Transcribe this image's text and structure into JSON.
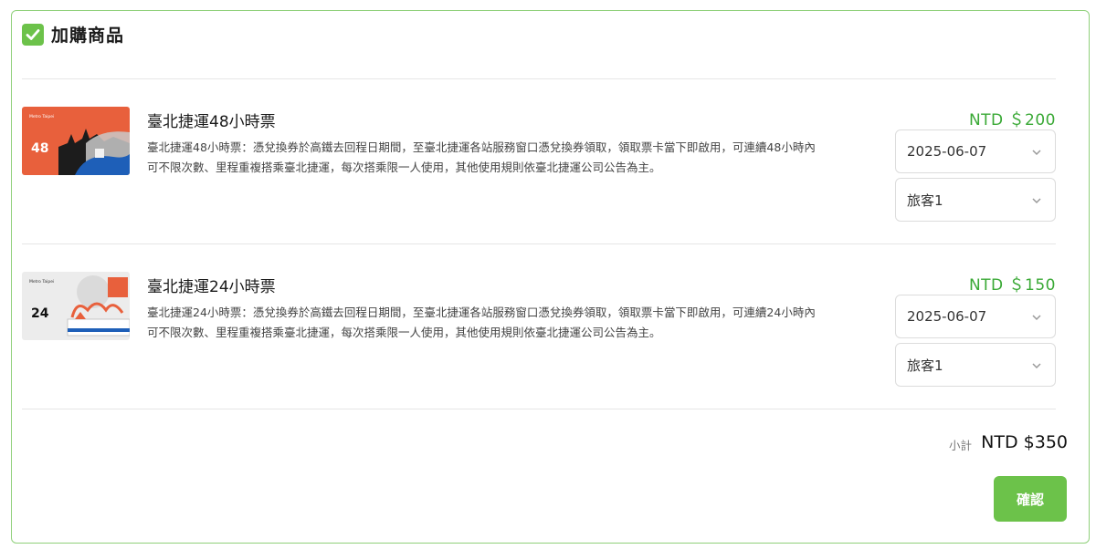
{
  "header": {
    "title": "加購商品",
    "icon": "checkbox-checked-icon"
  },
  "items": [
    {
      "name": "臺北捷運48小時票",
      "desc_line1": "臺北捷運48小時票：憑兌換券於高鐵去回程日期間，至臺北捷運各站服務窗口憑兌換券領取，領取票卡當下即啟用，可連續48小時內",
      "desc_line2": "可不限次數、里程重複搭乘臺北捷運，每次搭乘限一人使用，其他使用規則依臺北捷運公司公告為主。",
      "price": "NTD ＄200",
      "date": "2025-06-07",
      "traveler": "旅客1",
      "thumb_number": "48",
      "thumb_brand": "Metro Taipei"
    },
    {
      "name": "臺北捷運24小時票",
      "desc_line1": "臺北捷運24小時票：憑兌換券於高鐵去回程日期間，至臺北捷運各站服務窗口憑兌換券領取，領取票卡當下即啟用，可連續24小時內",
      "desc_line2": "可不限次數、里程重複搭乘臺北捷運，每次搭乘限一人使用，其他使用規則依臺北捷運公司公告為主。",
      "price": "NTD ＄150",
      "date": "2025-06-07",
      "traveler": "旅客1",
      "thumb_number": "24",
      "thumb_brand": "Metro Taipei"
    }
  ],
  "summary": {
    "label": "小計",
    "value": "NTD $350"
  },
  "actions": {
    "confirm_label": "確認"
  },
  "colors": {
    "accent": "#6cc24a",
    "price": "#3aa936",
    "border": "#8fd07a"
  }
}
